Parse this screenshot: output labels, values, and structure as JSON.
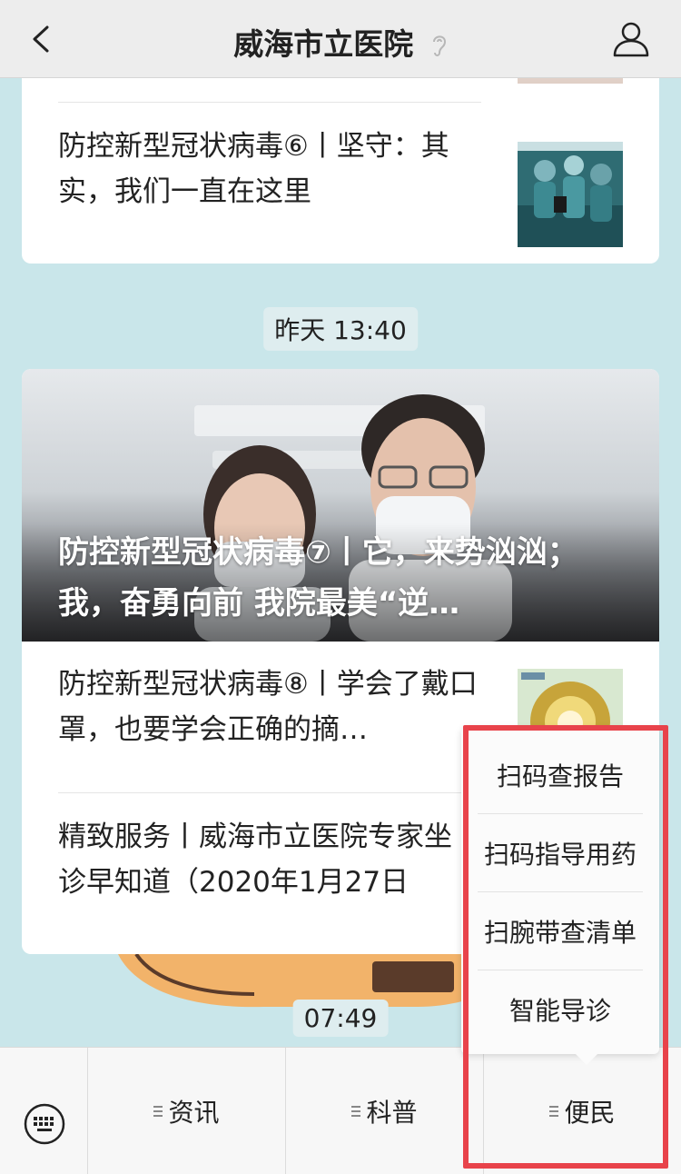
{
  "header": {
    "title": "威海市立医院"
  },
  "messages": {
    "card1": {
      "article": {
        "title": "防控新型冠状病毒⑥丨坚守：其实，我们一直在这里"
      }
    },
    "time1": "昨天 13:40",
    "card2": {
      "cover_title": "防控新型冠状病毒⑦丨它，来势汹汹；我，奋勇向前 我院最美“逆…",
      "article2": {
        "title": "防控新型冠状病毒⑧丨学会了戴口罩，也要学会正确的摘…"
      },
      "article3": {
        "title": "精致服务丨威海市立医院专家坐诊早知道（2020年1月27日"
      }
    },
    "time2": "07:49"
  },
  "bottom_menu": {
    "items": [
      {
        "label": "资讯"
      },
      {
        "label": "科普"
      },
      {
        "label": "便民"
      }
    ]
  },
  "popup_menu": {
    "items": [
      {
        "label": "扫码查报告"
      },
      {
        "label": "扫码指导用药"
      },
      {
        "label": "扫腕带查清单"
      },
      {
        "label": "智能导诊"
      }
    ]
  },
  "icons": {
    "back": "back-icon",
    "ear": "ear-icon",
    "profile": "profile-icon",
    "keyboard": "keyboard-icon",
    "menu": "menu-lines-icon"
  },
  "colors": {
    "highlight": "#e8434b",
    "chat_background": "#c9e6ea"
  }
}
